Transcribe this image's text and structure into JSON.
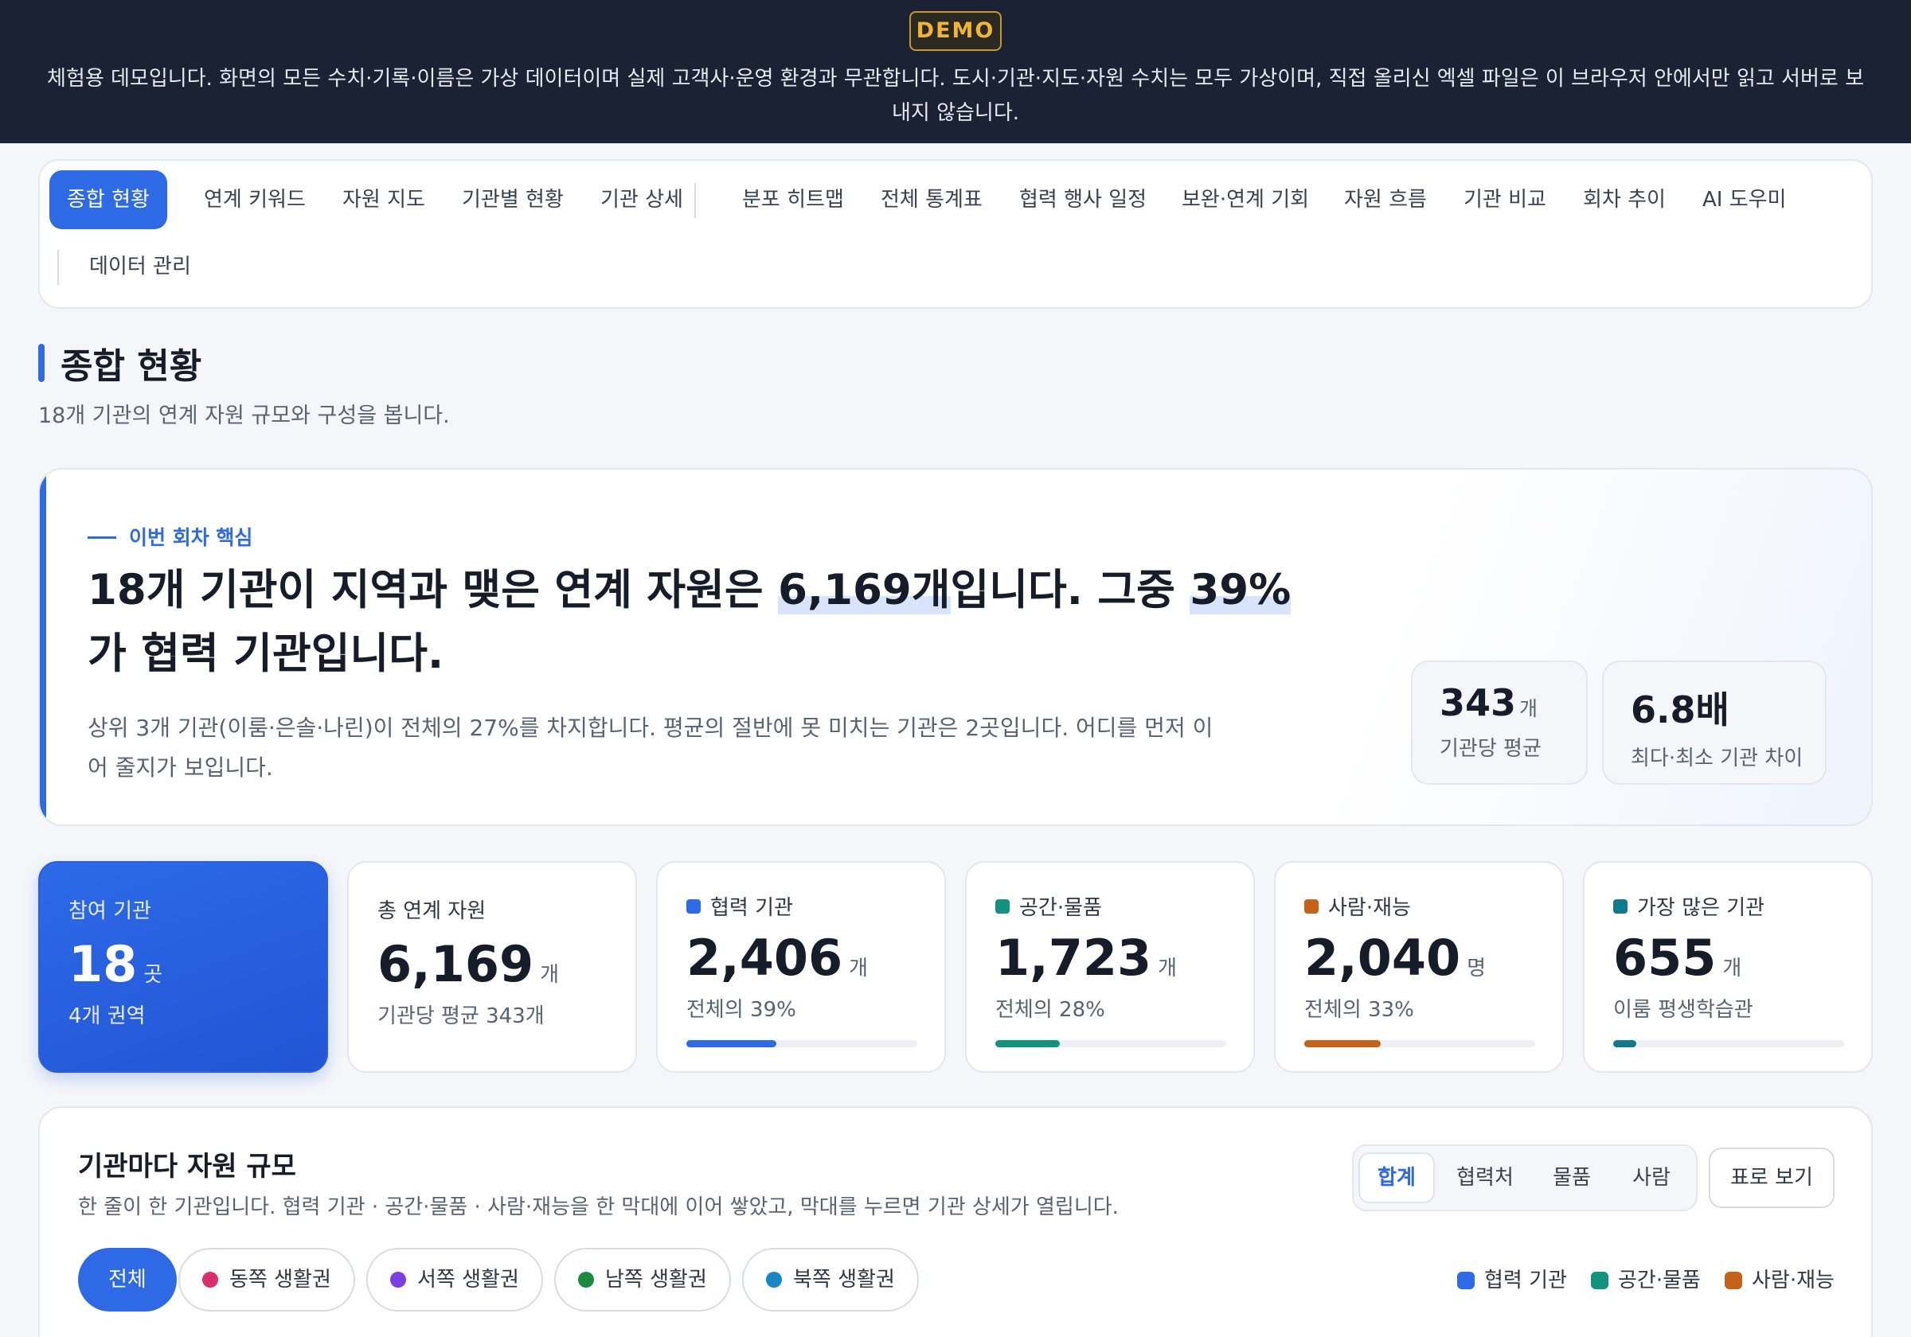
{
  "banner": {
    "badge": "DEMO",
    "text": "체험용 데모입니다. 화면의 모든 수치·기록·이름은 가상 데이터이며 실제 고객사·운영 환경과 무관합니다. 도시·기관·지도·자원 수치는 모두 가상이며, 직접 올리신 엑셀 파일은 이 브라우저 안에서만 읽고 서버로 보내지 않습니다."
  },
  "nav": {
    "items": [
      "종합 현황",
      "연계 키워드",
      "자원 지도",
      "기관별 현황",
      "기관 상세",
      "분포 히트맵",
      "전체 통계표",
      "협력 행사 일정",
      "보완·연계 기회",
      "자원 흐름",
      "기관 비교",
      "회차 추이",
      "AI 도우미",
      "데이터 관리"
    ],
    "active": "종합 현황"
  },
  "page": {
    "title": "종합 현황",
    "subtitle": "18개 기관의 연계 자원 규모와 구성을 봅니다."
  },
  "hero": {
    "eyebrow": "이번 회차 핵심",
    "headline_a": "18개 기관이 지역과 맺은 연계 자원은 ",
    "headline_hl1": "6,169개",
    "headline_b": "입니다. 그중 ",
    "headline_hl2": "39%",
    "headline_c": "가 협력 기관입니다.",
    "desc": "상위 3개 기관(이룸·은솔·나린)이 전체의 27%를 차지합니다. 평균의 절반에 못 미치는 기관은 2곳입니다. 어디를 먼저 이어 줄지가 보입니다.",
    "stats": [
      {
        "value": "343",
        "unit": "개",
        "label": "기관당 평균"
      },
      {
        "value": "6.8배",
        "unit": "",
        "label": "최다·최소 기관 차이"
      }
    ]
  },
  "kpis": [
    {
      "label": "참여 기관",
      "value": "18",
      "unit": "곳",
      "sub": "4개 권역",
      "primary": true
    },
    {
      "label": "총 연계 자원",
      "value": "6,169",
      "unit": "개",
      "sub": "기관당 평균 343개"
    },
    {
      "label": "협력 기관",
      "value": "2,406",
      "unit": "개",
      "sub": "전체의 39%",
      "color": "#2f6ae6",
      "fill": 0.39
    },
    {
      "label": "공간·물품",
      "value": "1,723",
      "unit": "개",
      "sub": "전체의 28%",
      "color": "#12927f",
      "fill": 0.28
    },
    {
      "label": "사람·재능",
      "value": "2,040",
      "unit": "명",
      "sub": "전체의 33%",
      "color": "#c4621a",
      "fill": 0.33
    },
    {
      "label": "가장 많은 기관",
      "value": "655",
      "unit": "개",
      "sub": "이룸 평생학습관",
      "color": "#127a8a",
      "fill": 0.1
    }
  ],
  "panel": {
    "title": "기관마다 자원 규모",
    "desc": "한 줄이 한 기관입니다. 협력 기관 · 공간·물품 · 사람·재능을 한 막대에 이어 쌓았고, 막대를 누르면 기관 상세가 열립니다.",
    "segments": [
      "합계",
      "협력처",
      "물품",
      "사람"
    ],
    "active_segment": "합계",
    "table_button": "표로 보기",
    "chips": [
      {
        "label": "전체",
        "active": true
      },
      {
        "label": "동쪽 생활권",
        "color": "#d82f6a"
      },
      {
        "label": "서쪽 생활권",
        "color": "#7b3fe0"
      },
      {
        "label": "남쪽 생활권",
        "color": "#198a3e"
      },
      {
        "label": "북쪽 생활권",
        "color": "#1a86c6"
      }
    ],
    "legend": [
      {
        "label": "협력 기관",
        "color": "#2f6ae6"
      },
      {
        "label": "공간·물품",
        "color": "#12927f"
      },
      {
        "label": "사람·재능",
        "color": "#c4621a"
      }
    ]
  }
}
